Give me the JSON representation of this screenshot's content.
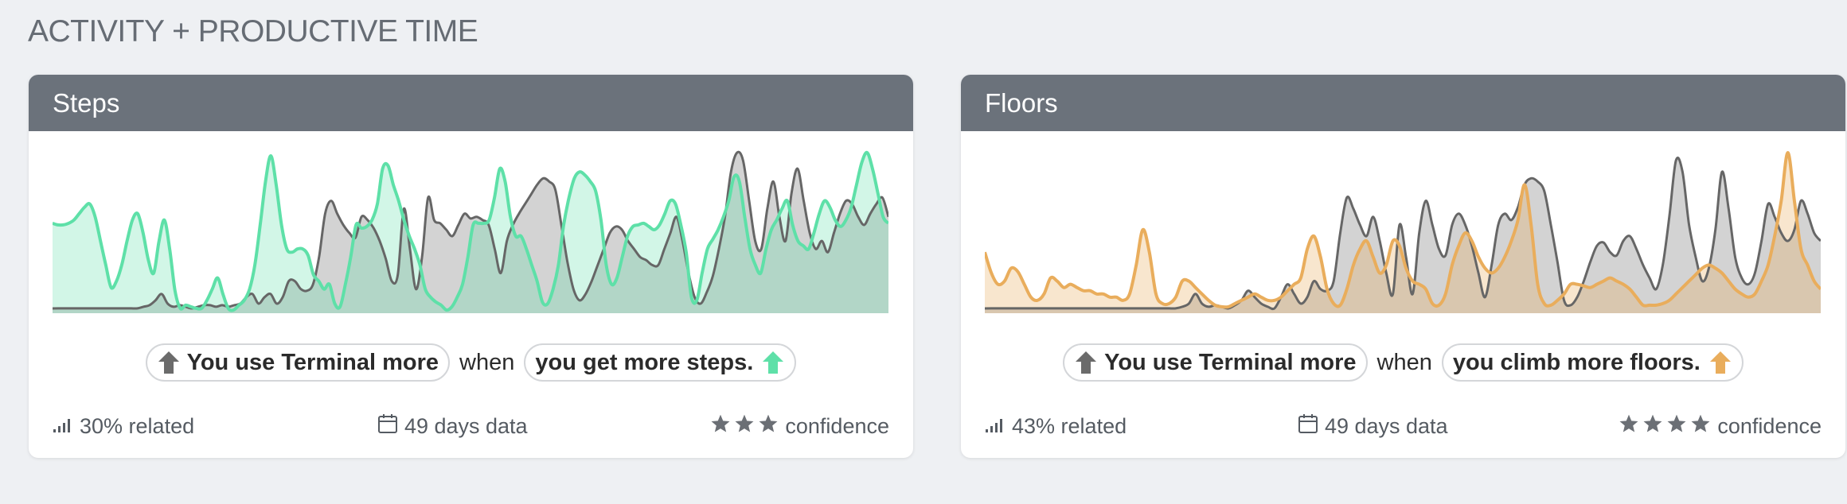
{
  "section": {
    "title": "ACTIVITY + PRODUCTIVE TIME"
  },
  "colors": {
    "background": "#eef0f3",
    "header": "#6b727b",
    "terminal_series": "#666666",
    "steps_series": "#5ee0a8",
    "floors_series": "#e9ad5c"
  },
  "cards": [
    {
      "title": "Steps",
      "subject_pill": "You use Terminal more",
      "connector": "when",
      "condition_pill": "you get more steps.",
      "related": "30% related",
      "days": "49 days data",
      "confidence_label": "confidence",
      "confidence_stars": 3,
      "icons": [
        "signal-bars-icon",
        "calendar-icon",
        "star-icon",
        "arrow-up-icon"
      ],
      "chart_data": {
        "type": "area",
        "series": [
          {
            "values": [
              0.03,
              0.03,
              0.03,
              0.03,
              0.03,
              0.03,
              0.03,
              0.03,
              0.03,
              0.03,
              0.03,
              0.03,
              0.03,
              0.03,
              0.03,
              0.04,
              0.05,
              0.08,
              0.12,
              0.06,
              0.04,
              0.05,
              0.04,
              0.03,
              0.04,
              0.05,
              0.05,
              0.04,
              0.05,
              0.04,
              0.05,
              0.06,
              0.1,
              0.12,
              0.06,
              0.1,
              0.12,
              0.06,
              0.1,
              0.2,
              0.2,
              0.15,
              0.14,
              0.18,
              0.35,
              0.62,
              0.7,
              0.62,
              0.55,
              0.5,
              0.47,
              0.6,
              0.58,
              0.53,
              0.45,
              0.34,
              0.2,
              0.24,
              0.65,
              0.4,
              0.15,
              0.35,
              0.72,
              0.58,
              0.56,
              0.52,
              0.48,
              0.55,
              0.62,
              0.59,
              0.6,
              0.58,
              0.55,
              0.4,
              0.25,
              0.45,
              0.55,
              0.62,
              0.68,
              0.74,
              0.8,
              0.84,
              0.82,
              0.77,
              0.55,
              0.32,
              0.15,
              0.08,
              0.12,
              0.2,
              0.3,
              0.4,
              0.5,
              0.54,
              0.52,
              0.45,
              0.4,
              0.35,
              0.33,
              0.3,
              0.3,
              0.4,
              0.5,
              0.6,
              0.45,
              0.25,
              0.1,
              0.06,
              0.13,
              0.23,
              0.4,
              0.6,
              0.88,
              1.0,
              0.95,
              0.7,
              0.45,
              0.4,
              0.65,
              0.82,
              0.6,
              0.45,
              0.75,
              0.9,
              0.7,
              0.5,
              0.4,
              0.45,
              0.38,
              0.5,
              0.62,
              0.7,
              0.68,
              0.6,
              0.55,
              0.62,
              0.68,
              0.72,
              0.6
            ]
          },
          {
            "values": [
              0.56,
              0.55,
              0.55,
              0.56,
              0.58,
              0.62,
              0.66,
              0.68,
              0.6,
              0.45,
              0.3,
              0.16,
              0.2,
              0.3,
              0.45,
              0.58,
              0.62,
              0.5,
              0.33,
              0.25,
              0.45,
              0.58,
              0.4,
              0.14,
              0.03,
              0.05,
              0.04,
              0.03,
              0.03,
              0.08,
              0.15,
              0.22,
              0.12,
              0.03,
              0.02,
              0.05,
              0.08,
              0.15,
              0.3,
              0.55,
              0.82,
              0.98,
              0.8,
              0.55,
              0.4,
              0.38,
              0.4,
              0.4,
              0.36,
              0.24,
              0.2,
              0.15,
              0.18,
              0.06,
              0.04,
              0.18,
              0.35,
              0.55,
              0.53,
              0.54,
              0.58,
              0.68,
              0.9,
              0.92,
              0.8,
              0.7,
              0.58,
              0.48,
              0.4,
              0.3,
              0.15,
              0.1,
              0.07,
              0.05,
              0.02,
              0.04,
              0.1,
              0.18,
              0.35,
              0.55,
              0.56,
              0.56,
              0.58,
              0.72,
              0.9,
              0.82,
              0.6,
              0.48,
              0.48,
              0.4,
              0.3,
              0.2,
              0.07,
              0.06,
              0.15,
              0.3,
              0.55,
              0.72,
              0.84,
              0.88,
              0.86,
              0.82,
              0.76,
              0.58,
              0.3,
              0.18,
              0.22,
              0.35,
              0.48,
              0.54,
              0.55,
              0.56,
              0.54,
              0.52,
              0.55,
              0.62,
              0.7,
              0.68,
              0.55,
              0.38,
              0.1,
              0.08,
              0.25,
              0.4,
              0.46,
              0.52,
              0.6,
              0.7,
              0.85,
              0.82,
              0.6,
              0.4,
              0.3,
              0.25,
              0.4,
              0.52,
              0.58,
              0.65,
              0.7,
              0.55,
              0.45,
              0.42,
              0.4,
              0.5,
              0.62,
              0.7,
              0.66,
              0.58,
              0.54,
              0.58,
              0.66,
              0.8,
              0.94,
              1.0,
              0.9,
              0.75,
              0.6,
              0.56
            ]
          }
        ]
      }
    },
    {
      "title": "Floors",
      "subject_pill": "You use Terminal more",
      "connector": "when",
      "condition_pill": "you climb more floors.",
      "related": "43% related",
      "days": "49 days data",
      "confidence_label": "confidence",
      "confidence_stars": 4,
      "icons": [
        "signal-bars-icon",
        "calendar-icon",
        "star-icon",
        "arrow-up-icon"
      ],
      "chart_data": {
        "type": "area",
        "series": [
          {
            "values": [
              0.03,
              0.03,
              0.03,
              0.03,
              0.03,
              0.03,
              0.03,
              0.03,
              0.03,
              0.03,
              0.03,
              0.03,
              0.03,
              0.03,
              0.03,
              0.03,
              0.03,
              0.03,
              0.03,
              0.03,
              0.03,
              0.03,
              0.03,
              0.03,
              0.03,
              0.03,
              0.03,
              0.03,
              0.03,
              0.03,
              0.04,
              0.06,
              0.12,
              0.06,
              0.04,
              0.05,
              0.04,
              0.03,
              0.05,
              0.08,
              0.14,
              0.1,
              0.06,
              0.04,
              0.03,
              0.1,
              0.18,
              0.12,
              0.06,
              0.1,
              0.2,
              0.15,
              0.14,
              0.2,
              0.5,
              0.72,
              0.65,
              0.55,
              0.48,
              0.6,
              0.45,
              0.25,
              0.12,
              0.55,
              0.35,
              0.12,
              0.5,
              0.7,
              0.55,
              0.4,
              0.36,
              0.55,
              0.62,
              0.55,
              0.42,
              0.25,
              0.1,
              0.3,
              0.55,
              0.62,
              0.58,
              0.66,
              0.8,
              0.84,
              0.82,
              0.76,
              0.55,
              0.32,
              0.08,
              0.05,
              0.1,
              0.2,
              0.32,
              0.42,
              0.44,
              0.38,
              0.36,
              0.45,
              0.48,
              0.4,
              0.3,
              0.22,
              0.15,
              0.3,
              0.6,
              0.95,
              0.88,
              0.55,
              0.35,
              0.2,
              0.28,
              0.52,
              0.88,
              0.65,
              0.35,
              0.22,
              0.18,
              0.25,
              0.45,
              0.68,
              0.6,
              0.5,
              0.45,
              0.52,
              0.7,
              0.62,
              0.5,
              0.45
            ]
          },
          {
            "values": [
              0.38,
              0.25,
              0.18,
              0.2,
              0.28,
              0.26,
              0.18,
              0.1,
              0.08,
              0.12,
              0.22,
              0.2,
              0.16,
              0.18,
              0.16,
              0.14,
              0.14,
              0.12,
              0.12,
              0.1,
              0.1,
              0.08,
              0.12,
              0.3,
              0.52,
              0.38,
              0.12,
              0.06,
              0.06,
              0.1,
              0.2,
              0.2,
              0.16,
              0.12,
              0.08,
              0.05,
              0.04,
              0.04,
              0.06,
              0.08,
              0.1,
              0.12,
              0.1,
              0.08,
              0.08,
              0.1,
              0.14,
              0.18,
              0.22,
              0.4,
              0.48,
              0.35,
              0.15,
              0.06,
              0.05,
              0.15,
              0.3,
              0.4,
              0.45,
              0.35,
              0.25,
              0.3,
              0.45,
              0.42,
              0.28,
              0.2,
              0.18,
              0.15,
              0.06,
              0.05,
              0.12,
              0.3,
              0.42,
              0.5,
              0.45,
              0.35,
              0.28,
              0.25,
              0.28,
              0.35,
              0.45,
              0.58,
              0.8,
              0.55,
              0.18,
              0.06,
              0.05,
              0.08,
              0.12,
              0.18,
              0.18,
              0.17,
              0.16,
              0.18,
              0.2,
              0.22,
              0.2,
              0.18,
              0.15,
              0.1,
              0.05,
              0.05,
              0.05,
              0.06,
              0.08,
              0.12,
              0.16,
              0.2,
              0.24,
              0.28,
              0.3,
              0.28,
              0.25,
              0.2,
              0.15,
              0.12,
              0.1,
              0.12,
              0.2,
              0.3,
              0.48,
              0.7,
              1.0,
              0.7,
              0.4,
              0.3,
              0.2,
              0.15
            ]
          }
        ]
      }
    }
  ]
}
